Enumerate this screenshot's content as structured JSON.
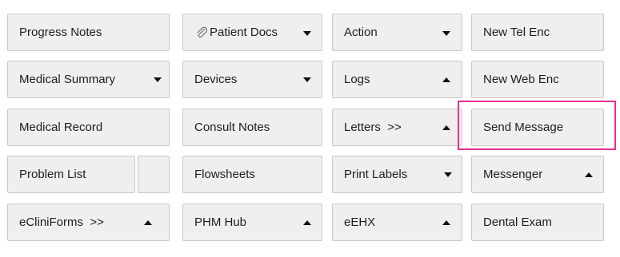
{
  "buttons": {
    "progress_notes": "Progress Notes",
    "patient_docs": "Patient Docs",
    "action": "Action",
    "new_tel_enc": "New Tel Enc",
    "medical_summary": "Medical Summary",
    "devices": "Devices",
    "logs": "Logs",
    "new_web_enc": "New Web Enc",
    "medical_record": "Medical Record",
    "consult_notes": "Consult Notes",
    "letters": "Letters  >>",
    "send_message": "Send Message",
    "problem_list": "Problem List",
    "flowsheets": "Flowsheets",
    "print_labels": "Print Labels",
    "messenger": "Messenger",
    "ecliniforms": "eCliniForms  >>",
    "phm_hub": "PHM Hub",
    "eehx": "eEHX",
    "dental_exam": "Dental Exam"
  },
  "icons": {
    "paperclip": "paperclip-icon",
    "dropdown": "chevron-down-icon",
    "expand": "chevron-up-icon"
  },
  "colors": {
    "highlight": "#e8308e",
    "button_bg": "#efefef",
    "button_border": "#c9c9c9"
  }
}
